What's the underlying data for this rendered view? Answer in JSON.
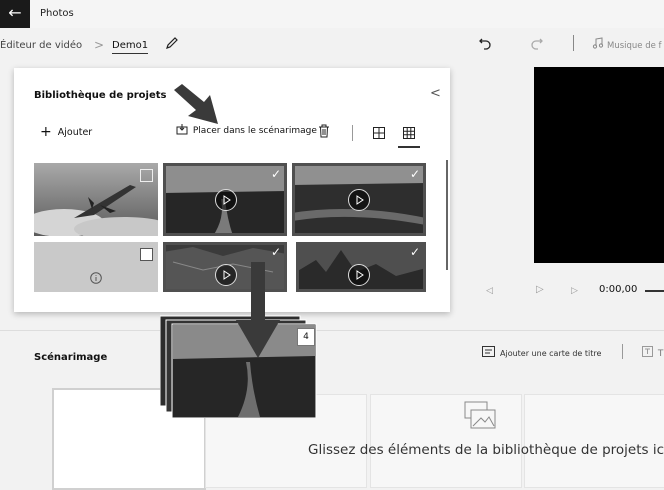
{
  "app": {
    "title": "Photos",
    "back_symbol": "←"
  },
  "breadcrumb": {
    "root": "Éditeur de vidéo",
    "separator": ">",
    "project": "Demo1"
  },
  "toolbar": {
    "music_label": "Musique de f"
  },
  "library": {
    "title": "Bibliothèque de projets",
    "add_label": "Ajouter",
    "place_label": "Placer dans le scénarimage",
    "collapse_symbol": "<",
    "items": [
      {
        "kind": "image",
        "selected": false
      },
      {
        "kind": "video",
        "selected": true
      },
      {
        "kind": "video",
        "selected": true
      },
      {
        "kind": "placeholder",
        "selected": false
      },
      {
        "kind": "video",
        "selected": true
      },
      {
        "kind": "video",
        "selected": true
      }
    ]
  },
  "player": {
    "time": "0:00,00",
    "prev_symbol": "◁",
    "play_symbol": "▷",
    "next_symbol": "▷"
  },
  "storyboard": {
    "title": "Scénarimage",
    "add_title_card_label": "Ajouter une carte de titre",
    "text_label": "T",
    "drop_hint": "Glissez des éléments de la bibliothèque de projets ici",
    "drag_count": "4"
  },
  "colors": {
    "accent_selected": "#505050",
    "panel_bg": "#ffffff",
    "page_bg": "#f2f2f2",
    "preview_bg": "#000000"
  }
}
